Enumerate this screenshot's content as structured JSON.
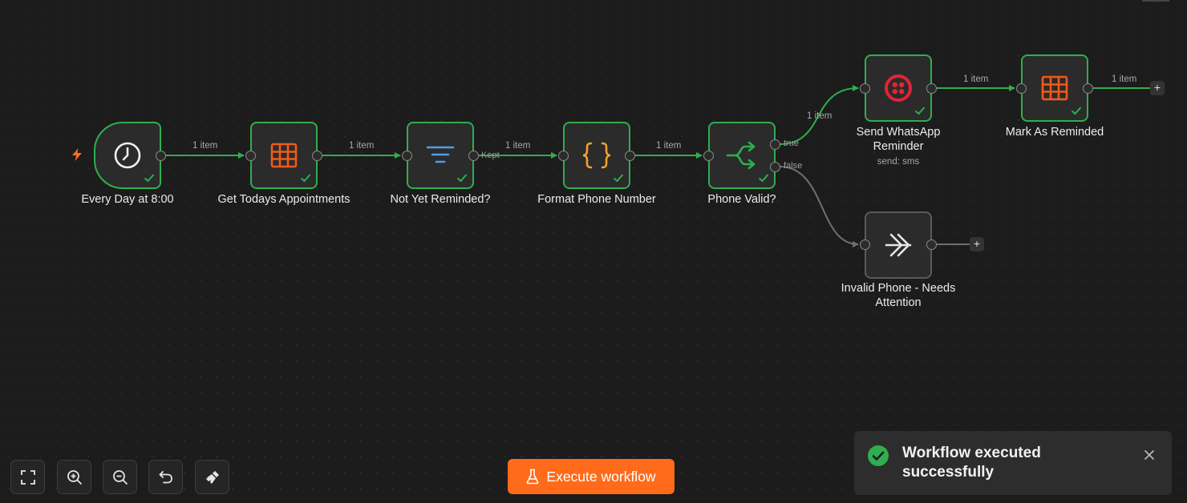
{
  "nodes": {
    "every_day": {
      "label": "Every Day at 8:00",
      "icon": "clock-icon"
    },
    "get_appointments": {
      "label": "Get Todays Appointments",
      "icon": "table-icon"
    },
    "not_yet_reminded": {
      "label": "Not Yet Reminded?",
      "icon": "filter-icon"
    },
    "format_phone": {
      "label": "Format Phone Number",
      "icon": "code-braces-icon"
    },
    "phone_valid": {
      "label": "Phone Valid?",
      "icon": "if-branch-icon"
    },
    "send_whatsapp": {
      "label": "Send WhatsApp Reminder",
      "subtitle": "send: sms",
      "icon": "twilio-icon"
    },
    "mark_reminded": {
      "label": "Mark As Reminded",
      "icon": "table-icon"
    },
    "invalid_phone": {
      "label": "Invalid Phone - Needs Attention",
      "icon": "no-op-icon"
    }
  },
  "edges": {
    "e1": "1 item",
    "e2": "1 item",
    "e3": "1 item",
    "e4": "1 item",
    "e5": "1 item",
    "e6": "1 item",
    "e7": "1 item"
  },
  "ports": {
    "kept": "Kept",
    "true": "true",
    "false": "false"
  },
  "toolbar": {
    "fit_view": "fit-view-icon",
    "zoom_in": "zoom-in-icon",
    "zoom_out": "zoom-out-icon",
    "undo": "undo-icon",
    "tidy_up": "broom-icon"
  },
  "execute": {
    "label": "Execute workflow",
    "icon": "flask-icon"
  },
  "toast": {
    "message": "Workflow executed successfully",
    "status": "success"
  },
  "colors": {
    "success": "#2fae4f",
    "accent": "#ff6b1a",
    "idle": "#5a5a5a",
    "table_icon": "#f05a1a",
    "filter_icon": "#4c9ef0",
    "code_icon": "#f0a030",
    "twilio": "#e22434"
  }
}
